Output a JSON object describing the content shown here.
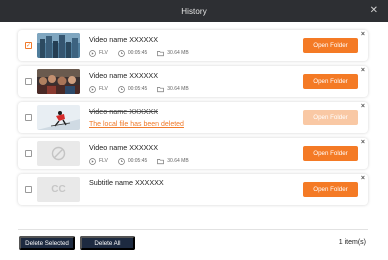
{
  "window": {
    "title": "History",
    "close_glyph": "✕"
  },
  "items": [
    {
      "checked": true,
      "thumb": "city-skyline",
      "name": "Video name XXXXXX",
      "format": "FLV",
      "duration": "00:05:45",
      "size": "30.64 MB",
      "button": "Open Folder",
      "deleted": false
    },
    {
      "checked": false,
      "thumb": "crowd-scene",
      "name": "Video name XXXXXX",
      "format": "FLV",
      "duration": "00:05:45",
      "size": "30.64 MB",
      "button": "Open Folder",
      "deleted": false
    },
    {
      "checked": false,
      "thumb": "skier-snow",
      "name": "Video name XXXXXX",
      "deleted_text": "The local file has been deleted",
      "button": "Open Folder",
      "deleted": true
    },
    {
      "checked": false,
      "thumb": "no-preview",
      "name": "Video name XXXXXX",
      "format": "FLV",
      "duration": "00:05:45",
      "size": "30.64 MB",
      "button": "Open Folder",
      "deleted": false
    },
    {
      "checked": false,
      "thumb": "subtitle-cc",
      "name": "Subtitle name XXXXXX",
      "button": "Open Folder",
      "deleted": false
    }
  ],
  "thumb_cc_text": "CC",
  "footer": {
    "delete_selected": "Delete Selected",
    "delete_all": "Delete All",
    "count": "1 item(s)"
  },
  "colors": {
    "accent": "#f47a25",
    "titlebar": "#2d2f33",
    "footer_button": "#1d2a40"
  }
}
